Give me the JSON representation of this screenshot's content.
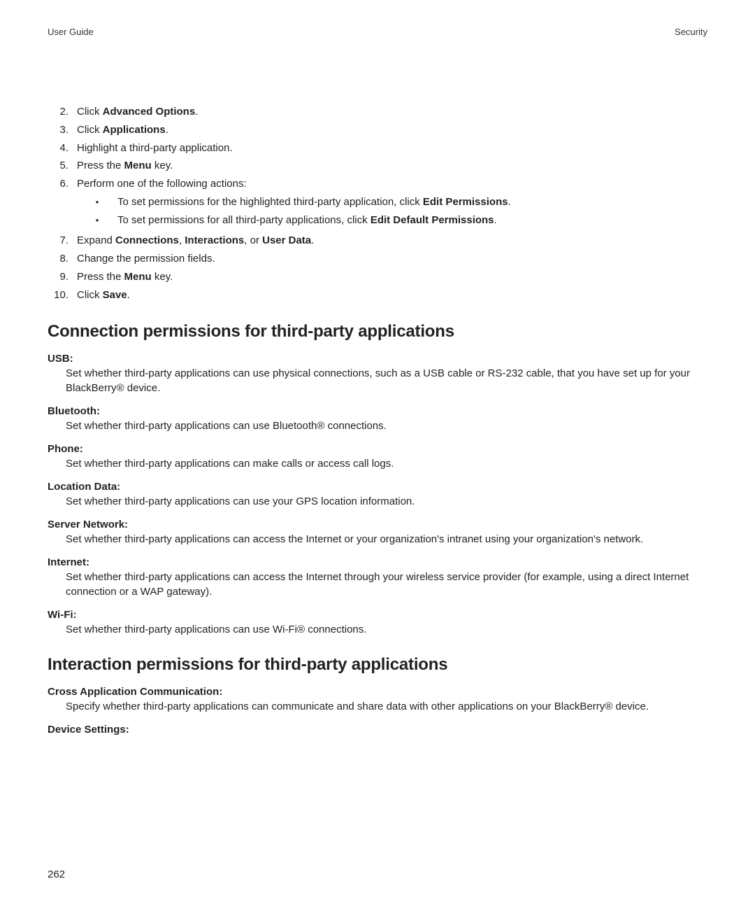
{
  "header": {
    "left": "User Guide",
    "right": "Security"
  },
  "steps": [
    {
      "num": "2.",
      "parts": [
        "Click ",
        "Advanced Options",
        "."
      ]
    },
    {
      "num": "3.",
      "parts": [
        "Click ",
        "Applications",
        "."
      ]
    },
    {
      "num": "4.",
      "plain": "Highlight a third-party application."
    },
    {
      "num": "5.",
      "parts": [
        "Press the ",
        "Menu",
        " key."
      ]
    },
    {
      "num": "6.",
      "plain": "Perform one of the following actions:",
      "subs": [
        {
          "pre": "To set permissions for the highlighted third-party application, click ",
          "bold": "Edit Permissions",
          "post": "."
        },
        {
          "pre": "To set permissions for all third-party applications, click ",
          "bold": "Edit Default Permissions",
          "post": "."
        }
      ]
    },
    {
      "num": "7.",
      "seg": {
        "a": "Expand ",
        "b1": "Connections",
        "c1": ", ",
        "b2": "Interactions",
        "c2": ", or ",
        "b3": "User Data",
        "c3": "."
      }
    },
    {
      "num": "8.",
      "plain": "Change the permission fields."
    },
    {
      "num": "9.",
      "parts": [
        "Press the ",
        "Menu",
        " key."
      ]
    },
    {
      "num": "10.",
      "parts": [
        "Click ",
        "Save",
        "."
      ]
    }
  ],
  "sections": [
    {
      "title": "Connection permissions for third-party applications",
      "items": [
        {
          "term": "USB:",
          "desc": "Set whether third-party applications can use physical connections, such as a USB cable or RS-232 cable, that you have set up for your BlackBerry® device."
        },
        {
          "term": "Bluetooth:",
          "desc": "Set whether third-party applications can use Bluetooth® connections."
        },
        {
          "term": "Phone:",
          "desc": "Set whether third-party applications can make calls or access call logs."
        },
        {
          "term": "Location Data:",
          "desc": "Set whether third-party applications can use your GPS location information."
        },
        {
          "term": "Server Network:",
          "desc": "Set whether third-party applications can access the Internet or your organization's intranet using your organization's network."
        },
        {
          "term": "Internet:",
          "desc": "Set whether third-party applications can access the Internet through your wireless service provider (for example, using a direct Internet connection or a WAP gateway)."
        },
        {
          "term": "Wi-Fi:",
          "desc": "Set whether third-party applications can use Wi-Fi® connections."
        }
      ]
    },
    {
      "title": "Interaction permissions for third-party applications",
      "items": [
        {
          "term": "Cross Application Communication:",
          "desc": "Specify whether third-party applications can communicate and share data with other applications on your BlackBerry® device."
        },
        {
          "term": "Device Settings:",
          "desc": ""
        }
      ]
    }
  ],
  "page_number": "262"
}
